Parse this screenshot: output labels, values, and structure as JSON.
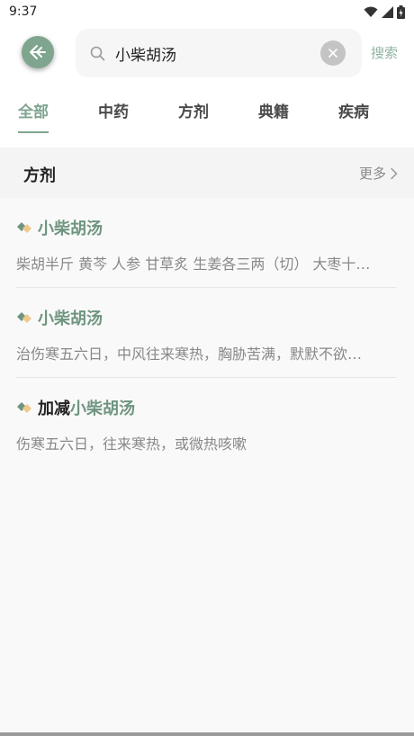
{
  "status": {
    "time": "9:37"
  },
  "search": {
    "query": "小柴胡汤",
    "action_label": "搜索"
  },
  "tabs": [
    {
      "label": "全部",
      "active": true
    },
    {
      "label": "中药",
      "active": false
    },
    {
      "label": "方剂",
      "active": false
    },
    {
      "label": "典籍",
      "active": false
    },
    {
      "label": "疾病",
      "active": false
    }
  ],
  "section": {
    "title": "方剂",
    "more_label": "更多"
  },
  "results": [
    {
      "prefix": "",
      "highlight": "小柴胡汤",
      "desc": "柴胡半斤 黄芩 人参 甘草炙 生姜各三两（切） 大枣十…"
    },
    {
      "prefix": "",
      "highlight": "小柴胡汤",
      "desc": "治伤寒五六日，中风往来寒热，胸胁苦满，默默不欲…"
    },
    {
      "prefix": "加减",
      "highlight": "小柴胡汤",
      "desc": "伤寒五六日，往来寒热，或微热咳嗽"
    }
  ],
  "colors": {
    "accent": "#7fa58f",
    "highlight_text": "#6f9580"
  },
  "icons": {
    "back": "back-arrow-icon",
    "search": "search-icon",
    "clear": "clear-icon",
    "more": "chevron-right-icon",
    "item": "herb-leaf-icon"
  }
}
